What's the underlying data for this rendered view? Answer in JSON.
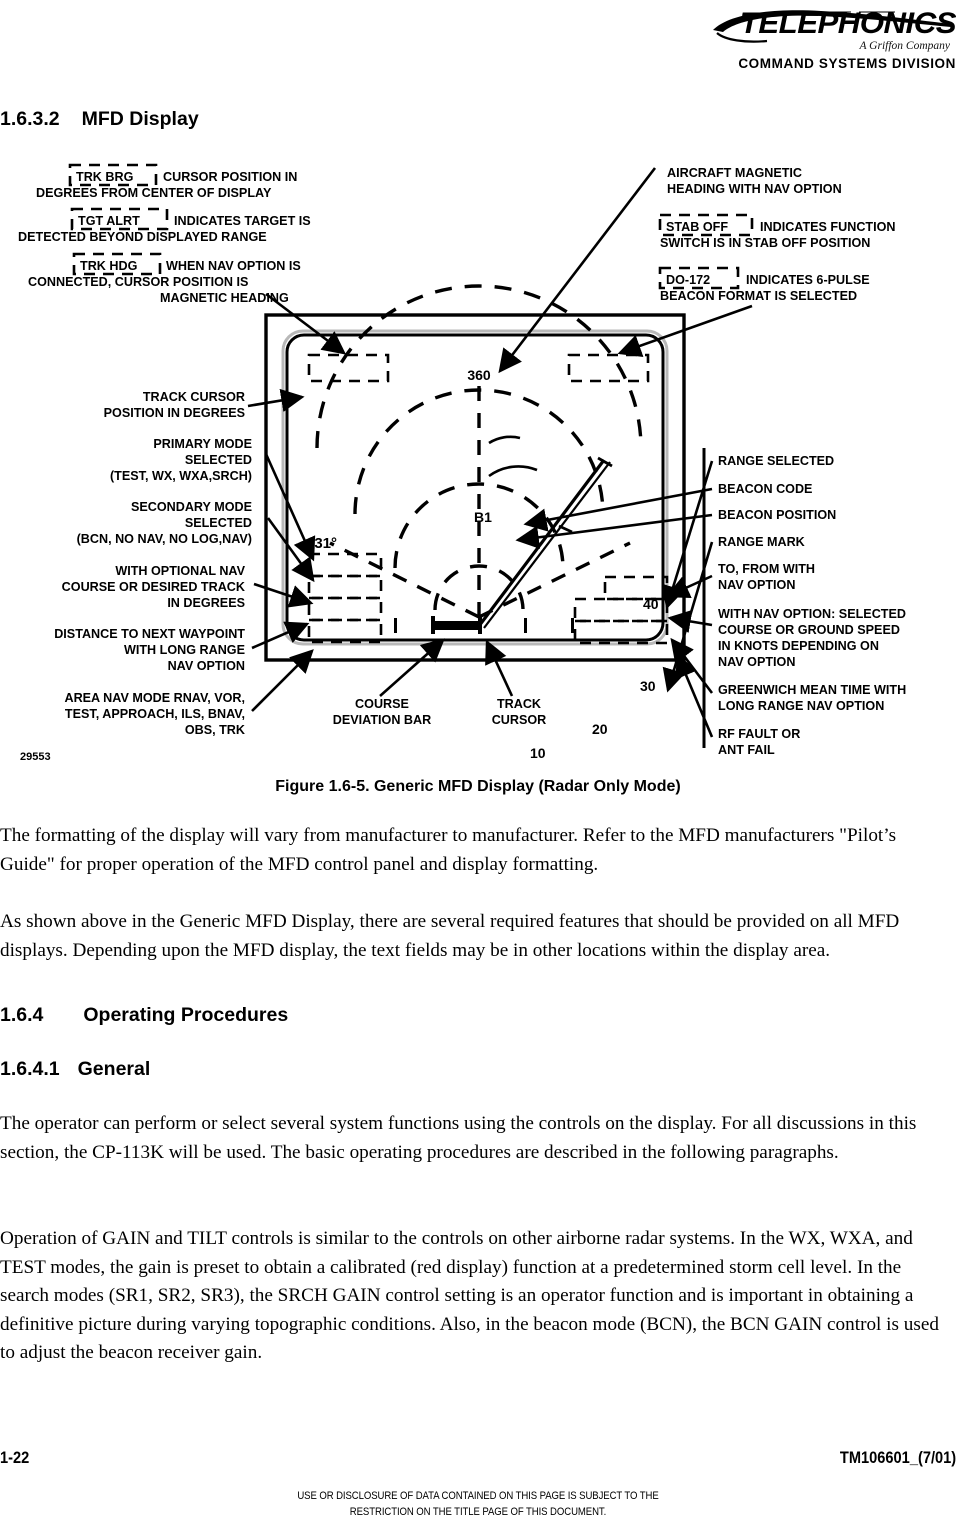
{
  "header": {
    "brand": "TELEPHONICS",
    "tagline": "A Griffon Company",
    "division_1": "C",
    "division_rest_1": "OMMAND",
    "division_2": "S",
    "division_rest_2": "YSTEMS",
    "division_3": "D",
    "division_rest_3": "IVISION",
    "division_full": "COMMAND SYSTEMS DIVISION"
  },
  "sections": {
    "s_1632_num": "1.6.3.2",
    "s_1632_title": "MFD Display",
    "s_164_num": "1.6.4",
    "s_164_title": "Operating Procedures",
    "s_1641_num": "1.6.4.1",
    "s_1641_title": "General"
  },
  "figure": {
    "caption": "Figure 1.6-5.  Generic MFD Display (Radar Only Mode)",
    "drawing_number": "29553",
    "screen_values": {
      "heading": "360",
      "track_cursor_degrees": "031°",
      "beacon_code": "B1",
      "range_40": "40",
      "range_30": "30",
      "range_20": "20",
      "range_10": "10"
    },
    "callouts_left": [
      {
        "id": "trk-brg",
        "boxed": "TRK BRG",
        "lines": [
          "CURSOR POSITION IN",
          "DEGREES FROM CENTER OF DISPLAY"
        ]
      },
      {
        "id": "tgt-alrt",
        "boxed": "TGT ALRT",
        "lines": [
          "INDICATES TARGET IS",
          "DETECTED BEYOND DISPLAYED RANGE"
        ]
      },
      {
        "id": "trk-hdg",
        "boxed": "TRK HDG",
        "lines": [
          "WHEN NAV OPTION IS",
          "CONNECTED, CURSOR POSITION IS",
          "MAGNETIC HEADING"
        ]
      },
      {
        "id": "track-cursor-position",
        "boxed": "",
        "lines": [
          "TRACK CURSOR",
          "POSITION IN DEGREES"
        ]
      },
      {
        "id": "primary-mode",
        "boxed": "",
        "lines": [
          "PRIMARY MODE",
          "SELECTED",
          "(TEST, WX, WXA,SRCH)"
        ]
      },
      {
        "id": "secondary-mode",
        "boxed": "",
        "lines": [
          "SECONDARY MODE",
          "SELECTED",
          "(BCN, NO NAV, NO LOG,NAV)"
        ]
      },
      {
        "id": "optional-nav-course",
        "boxed": "",
        "lines": [
          "WITH OPTIONAL NAV",
          "COURSE OR DESIRED TRACK",
          "IN DEGREES"
        ]
      },
      {
        "id": "distance-waypoint",
        "boxed": "",
        "lines": [
          "DISTANCE TO NEXT WAYPOINT",
          "WITH LONG RANGE",
          "NAV OPTION"
        ]
      },
      {
        "id": "area-nav-mode",
        "boxed": "",
        "lines": [
          "AREA NAV MODE RNAV, VOR,",
          "TEST, APPROACH, ILS, BNAV,",
          "OBS, TRK"
        ]
      }
    ],
    "callouts_right": [
      {
        "id": "aircraft-magnetic-heading",
        "boxed": "",
        "lines": [
          "AIRCRAFT MAGNETIC",
          "HEADING WITH NAV OPTION"
        ]
      },
      {
        "id": "stab-off",
        "boxed": "STAB OFF",
        "lines": [
          "INDICATES FUNCTION",
          "SWITCH IS IN STAB OFF POSITION"
        ]
      },
      {
        "id": "do-172",
        "boxed": "DO-172",
        "lines": [
          "INDICATES 6-PULSE",
          "BEACON FORMAT IS SELECTED"
        ]
      },
      {
        "id": "range-selected",
        "boxed": "",
        "lines": [
          "RANGE SELECTED"
        ]
      },
      {
        "id": "beacon-code",
        "boxed": "",
        "lines": [
          "BEACON CODE"
        ]
      },
      {
        "id": "beacon-position",
        "boxed": "",
        "lines": [
          "BEACON POSITION"
        ]
      },
      {
        "id": "range-mark",
        "boxed": "",
        "lines": [
          "RANGE MARK"
        ]
      },
      {
        "id": "to-from",
        "boxed": "",
        "lines": [
          "TO, FROM WITH",
          "NAV OPTION"
        ]
      },
      {
        "id": "selected-course-ground-speed",
        "boxed": "",
        "lines": [
          "WITH NAV OPTION: SELECTED",
          "COURSE OR GROUND SPEED",
          "IN KNOTS DEPENDING ON",
          "NAV OPTION"
        ]
      },
      {
        "id": "greenwich-mean-time",
        "boxed": "",
        "lines": [
          "GREENWICH MEAN TIME WITH",
          "LONG RANGE NAV OPTION"
        ]
      },
      {
        "id": "rf-fault",
        "boxed": "",
        "lines": [
          "RF FAULT OR",
          "ANT FAIL"
        ]
      }
    ],
    "callouts_bottom": [
      {
        "id": "course-deviation-bar",
        "lines": [
          "COURSE",
          "DEVIATION BAR"
        ]
      },
      {
        "id": "track-cursor",
        "lines": [
          "TRACK",
          "CURSOR"
        ]
      }
    ]
  },
  "body": {
    "p1": "The formatting of the display will vary from manufacturer to manufacturer.  Refer to the MFD manufacturers \"Pilot’s Guide\" for proper operation of the MFD control panel and display formatting.",
    "p2": "As shown above in the Generic MFD Display, there are several required features that should be provided on all MFD displays.  Depending upon the MFD display, the text fields may be in other locations within the display area.",
    "p3": "The operator can perform or select several system functions using the controls on the display.  For all discussions in this section, the CP-113K will be used.  The basic operating procedures are described in the following paragraphs.",
    "p4": "Operation of GAIN and TILT controls is similar to the controls on other airborne radar systems.  In the WX, WXA, and TEST modes, the gain is preset to obtain a calibrated (red display) function at a predetermined storm cell level.  In the search modes (SR1, SR2, SR3), the SRCH GAIN control setting is an operator function and is important in obtaining a definitive picture during varying topographic conditions.  Also, in the beacon mode (BCN), the BCN GAIN control is used to adjust the beacon receiver gain."
  },
  "footer": {
    "page": "1-22",
    "document": "TM106601_(7/01)",
    "notice_line1": "USE OR DISCLOSURE OF DATA CONTAINED ON THIS PAGE IS SUBJECT TO THE",
    "notice_line2": "RESTRICTION ON THE TITLE PAGE OF THIS DOCUMENT."
  }
}
